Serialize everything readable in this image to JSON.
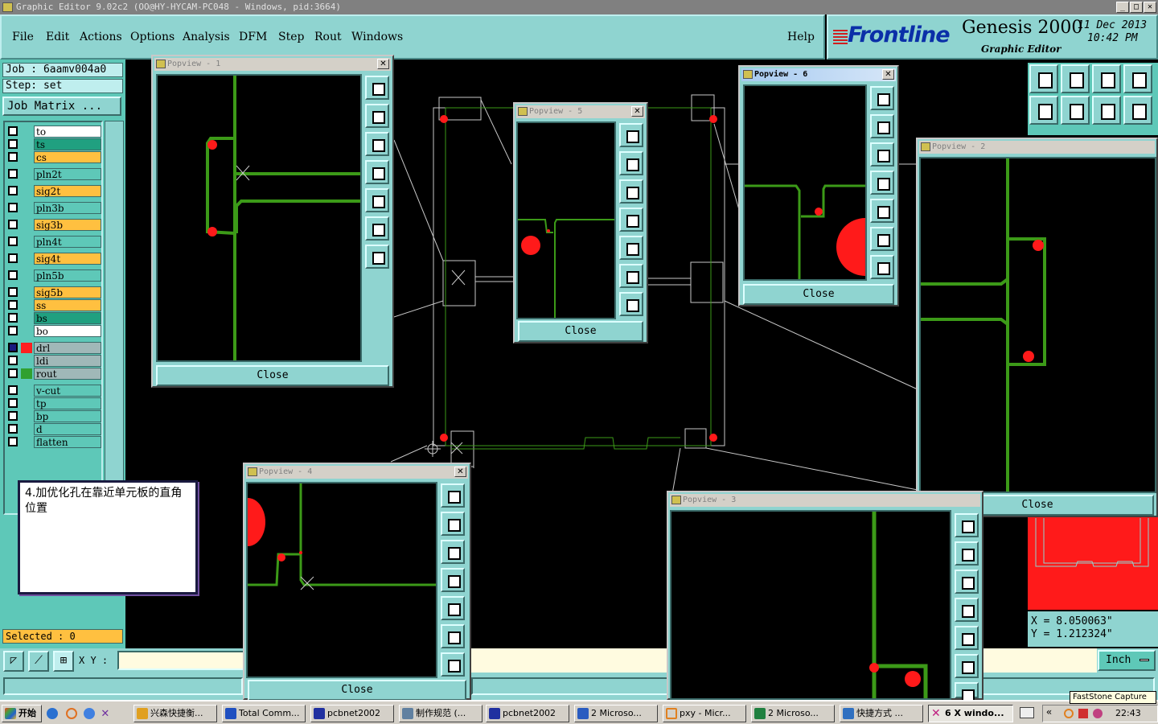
{
  "window": {
    "title": "Graphic Editor 9.02c2  (OO@HY-HYCAM-PC048 - Windows, pid:3664)"
  },
  "menu": [
    "File",
    "Edit",
    "Actions",
    "Options",
    "Analysis",
    "DFM",
    "Step",
    "Rout",
    "Windows"
  ],
  "help_label": "Help",
  "brand": {
    "logo": "Frontline",
    "product": "Genesis 2000",
    "subtitle": "Graphic Editor",
    "date": "11 Dec 2013",
    "time": "10:42 PM"
  },
  "job": {
    "label": "Job  :  6aamv004a0",
    "step": "Step:  set",
    "matrix_button": "Job Matrix ..."
  },
  "layers": [
    {
      "name": "to",
      "color": "#ffffff"
    },
    {
      "name": "ts",
      "color": "#20a080"
    },
    {
      "name": "cs",
      "color": "#ffc040"
    },
    {
      "name": "pln2t",
      "color": "#5ec8b8"
    },
    {
      "name": "sig2t",
      "color": "#ffc040"
    },
    {
      "name": "pln3b",
      "color": "#5ec8b8"
    },
    {
      "name": "sig3b",
      "color": "#ffc040"
    },
    {
      "name": "pln4t",
      "color": "#5ec8b8"
    },
    {
      "name": "sig4t",
      "color": "#ffc040"
    },
    {
      "name": "pln5b",
      "color": "#5ec8b8"
    },
    {
      "name": "sig5b",
      "color": "#ffc040"
    },
    {
      "name": "ss",
      "color": "#ffc040"
    },
    {
      "name": "bs",
      "color": "#20a080"
    },
    {
      "name": "bo",
      "color": "#ffffff"
    },
    {
      "name": "drl",
      "color": "#a0b8b8",
      "swatch": "#ff2020",
      "active": true
    },
    {
      "name": "ldi",
      "color": "#a0b8b8"
    },
    {
      "name": "rout",
      "color": "#a0b8b8",
      "swatch": "#30a030"
    },
    {
      "name": "v-cut",
      "color": "#5ec8b8"
    },
    {
      "name": "tp",
      "color": "#5ec8b8"
    },
    {
      "name": "bp",
      "color": "#5ec8b8"
    },
    {
      "name": "d",
      "color": "#5ec8b8"
    },
    {
      "name": "flatten",
      "color": "#5ec8b8"
    }
  ],
  "selected": "Selected : 0",
  "note": "4.加优化孔在靠近单元板的直角位置",
  "xy_label": "X Y :",
  "coords": {
    "x": "X  =  8.050063\"",
    "y": "Y  =  1.212324\""
  },
  "units": "Inch",
  "close_label": "Close",
  "popviews": {
    "p1": "Popview - 1",
    "p2": "Popview - 2",
    "p3": "Popview - 3",
    "p4": "Popview - 4",
    "p5": "Popview - 5",
    "p6": "Popview - 6"
  },
  "taskbar": {
    "start": "开始",
    "tasks": [
      "兴森快捷衡...",
      "Total Comm...",
      "pcbnet2002",
      "制作规范  (...",
      "pcbnet2002",
      "2 Microso...",
      "pxy - Micr...",
      "2 Microso...",
      "快捷方式 ...",
      "6 X windo..."
    ],
    "clock": "22:43",
    "tooltip": "FastStone Capture"
  },
  "colors": {
    "panel": "#8fd4d0",
    "trace": "#3c9a18",
    "pad": "#ff1a1a",
    "outline": "#c8c8c8"
  }
}
